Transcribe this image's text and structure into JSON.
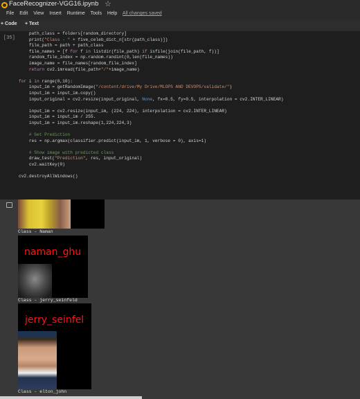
{
  "header": {
    "title": "FaceRecognizer-VGG16.ipynb",
    "menus": [
      "File",
      "Edit",
      "View",
      "Insert",
      "Runtime",
      "Tools",
      "Help"
    ],
    "save_status": "All changes saved"
  },
  "toolbar": {
    "code_label": "+ Code",
    "text_label": "+ Text"
  },
  "cell": {
    "execution_count": "[35]",
    "code_lines": [
      "    path_class = folders[random_directory]",
      "    print(\"Class - \" + five_celeb_dict_n[str(path_class)])",
      "    file_path = path + path_class",
      "    file_names = [f for f in listdir(file_path) if isfile(join(file_path, f))]",
      "    random_file_index = np.random.randint(0,len(file_names))",
      "    image_name = file_names[random_file_index]",
      "    return cv2.imread(file_path+\"/\"+image_name)",
      "",
      "for i in range(0,10):",
      "    input_im = getRandomImage(\"/content/drive/My Drive/MLOPS AND DEVOPS/validate/\")",
      "    input_im = input_im.copy()",
      "    input_original = cv2.resize(input_original, None, fx=0.5, fy=0.5, interpolation = cv2.INTER_LINEAR)",
      "",
      "    input_im = cv2.resize(input_im, (224, 224), interpolation = cv2.INTER_LINEAR)",
      "    input_im = input_im / 255.",
      "    input_im = input_im.reshape(1,224,224,3)",
      "",
      "    # Get Prediction",
      "    res = np.argmax(classifier.predict(input_im, 1, verbose = 0), axis=1)",
      "",
      "    # Show image with predicted class",
      "    draw_test(\"Prediction\", res, input_original)",
      "    cv2.waitKey(0)",
      "",
      "cv2.destroyAllWindows()"
    ]
  },
  "output": {
    "captions": [
      "Class - Naman",
      "Class - jerry_seinfeld",
      "Class - elton_john"
    ],
    "predictions": [
      "naman_ghu",
      "jerry_seinfel"
    ]
  },
  "colors": {
    "prediction_text": "#ff1414",
    "code_bg": "#1e1e1e",
    "page_bg": "#383838"
  }
}
